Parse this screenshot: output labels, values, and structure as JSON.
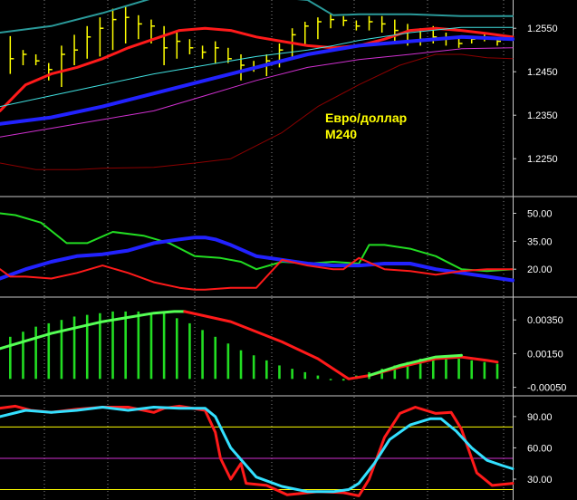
{
  "chart_data": [
    {
      "type": "line",
      "panel": "price",
      "annotation": [
        "Евро/доллар",
        "M240"
      ],
      "y_ticks": [
        "1.2550",
        "1.2450",
        "1.2350",
        "1.2250"
      ],
      "y_tick_values": [
        1.255,
        1.245,
        1.235,
        1.225
      ],
      "ylim": [
        1.2165,
        1.2615
      ],
      "xlim": [
        0,
        100
      ],
      "grid": "vertical dotted",
      "ohlc": {
        "color": "#ffff00",
        "x": [
          2,
          4.5,
          7,
          9.5,
          12,
          14.5,
          17,
          19.5,
          22,
          24.5,
          27,
          29.5,
          32,
          34.5,
          37,
          39.5,
          42,
          44.5,
          47,
          49.5,
          52,
          54.5,
          57,
          59.5,
          62,
          64.5,
          67,
          69.5,
          72,
          74.5,
          77,
          79.5,
          82,
          84.5,
          87,
          89.5,
          92,
          94.5,
          97
        ],
        "high": [
          1.2532,
          1.25,
          1.249,
          1.247,
          1.251,
          1.2535,
          1.2555,
          1.2575,
          1.2595,
          1.26,
          1.258,
          1.257,
          1.2555,
          1.254,
          1.2525,
          1.251,
          1.252,
          1.2505,
          1.249,
          1.2475,
          1.249,
          1.2515,
          1.255,
          1.2565,
          1.2575,
          1.2585,
          1.2578,
          1.2568,
          1.2578,
          1.2578,
          1.257,
          1.256,
          1.255,
          1.2555,
          1.254,
          1.253,
          1.253,
          1.254,
          1.253
        ],
        "low": [
          1.2445,
          1.2465,
          1.2465,
          1.243,
          1.2415,
          1.2465,
          1.248,
          1.2485,
          1.25,
          1.2515,
          1.2525,
          1.2515,
          1.2465,
          1.248,
          1.249,
          1.248,
          1.247,
          1.247,
          1.243,
          1.245,
          1.244,
          1.246,
          1.248,
          1.251,
          1.2525,
          1.255,
          1.2555,
          1.2545,
          1.2545,
          1.254,
          1.252,
          1.251,
          1.251,
          1.2515,
          1.251,
          1.2505,
          1.2515,
          1.252,
          1.251
        ],
        "close": [
          1.248,
          1.249,
          1.2475,
          1.2455,
          1.249,
          1.25,
          1.253,
          1.255,
          1.257,
          1.2575,
          1.256,
          1.2555,
          1.2505,
          1.252,
          1.2505,
          1.2495,
          1.2505,
          1.248,
          1.2465,
          1.246,
          1.2475,
          1.25,
          1.2535,
          1.2555,
          1.2565,
          1.257,
          1.2568,
          1.2555,
          1.2565,
          1.256,
          1.2545,
          1.252,
          1.2525,
          1.253,
          1.2525,
          1.2515,
          1.2525,
          1.253,
          1.252
        ]
      },
      "series": [
        {
          "color": "#2a9a9a",
          "width": 2,
          "x": [
            0,
            10,
            20,
            30,
            40,
            50,
            60,
            65,
            70,
            80,
            90,
            100
          ],
          "y": [
            1.254,
            1.2555,
            1.2585,
            1.262,
            1.263,
            1.2625,
            1.2615,
            1.258,
            1.2582,
            1.2582,
            1.2578,
            1.2578
          ]
        },
        {
          "color": "#ff1a1a",
          "width": 3,
          "x": [
            0,
            5,
            10,
            15,
            20,
            25,
            30,
            35,
            40,
            45,
            50,
            55,
            60,
            65,
            70,
            75,
            80,
            85,
            90,
            95,
            100
          ],
          "y": [
            1.236,
            1.242,
            1.2445,
            1.246,
            1.248,
            1.2505,
            1.2525,
            1.2545,
            1.255,
            1.2545,
            1.253,
            1.252,
            1.251,
            1.2505,
            1.251,
            1.2525,
            1.2545,
            1.255,
            1.2545,
            1.2538,
            1.253
          ]
        },
        {
          "color": "#40e0e0",
          "width": 1,
          "x": [
            0,
            10,
            20,
            30,
            40,
            50,
            60,
            65,
            70,
            80,
            90,
            100
          ],
          "y": [
            1.237,
            1.2395,
            1.242,
            1.2445,
            1.2465,
            1.2485,
            1.25,
            1.251,
            1.2522,
            1.254,
            1.2552,
            1.2552
          ]
        },
        {
          "color": "#2222ff",
          "width": 4,
          "x": [
            0,
            10,
            20,
            30,
            40,
            50,
            60,
            70,
            80,
            90,
            100
          ],
          "y": [
            1.233,
            1.2345,
            1.237,
            1.24,
            1.243,
            1.246,
            1.249,
            1.251,
            1.252,
            1.253,
            1.2525
          ]
        },
        {
          "color": "#d030d0",
          "width": 1,
          "x": [
            0,
            10,
            20,
            30,
            40,
            50,
            60,
            70,
            80,
            90,
            100
          ],
          "y": [
            1.23,
            1.232,
            1.234,
            1.236,
            1.2395,
            1.243,
            1.246,
            1.2478,
            1.249,
            1.2503,
            1.2505
          ]
        },
        {
          "color": "#8b0000",
          "width": 1,
          "x": [
            0,
            7,
            15,
            20,
            30,
            38,
            45,
            55,
            62,
            70,
            78,
            85,
            90,
            95,
            100
          ],
          "y": [
            1.224,
            1.2225,
            1.2225,
            1.2228,
            1.223,
            1.224,
            1.225,
            1.231,
            1.237,
            1.242,
            1.2465,
            1.249,
            1.249,
            1.2482,
            1.248
          ]
        }
      ]
    },
    {
      "type": "line",
      "panel": "dmi",
      "y_ticks": [
        "50.00",
        "35.00",
        "20.00"
      ],
      "y_tick_values": [
        50,
        35,
        20
      ],
      "ylim": [
        5.5,
        58.5
      ],
      "xlim": [
        0,
        100
      ],
      "grid": "vertical dotted",
      "series": [
        {
          "color": "#22dd22",
          "width": 2,
          "x": [
            0,
            3,
            8,
            13,
            17,
            22,
            28,
            33,
            38,
            43,
            47,
            50,
            55,
            60,
            65,
            70,
            72,
            75,
            80,
            85,
            90,
            95,
            100
          ],
          "y": [
            50,
            49,
            45,
            34,
            34,
            40,
            38,
            34,
            27,
            26,
            24,
            20,
            24,
            23,
            24,
            23,
            33,
            33,
            31,
            27,
            20,
            19,
            20
          ]
        },
        {
          "color": "#2222ff",
          "width": 4,
          "x": [
            0,
            5,
            10,
            15,
            20,
            25,
            30,
            35,
            38,
            40,
            42,
            45,
            50,
            55,
            60,
            65,
            70,
            75,
            80,
            85,
            90,
            95,
            100
          ],
          "y": [
            15,
            20,
            24,
            27,
            28,
            30,
            34,
            36,
            37,
            37,
            36,
            33,
            27,
            25,
            23,
            22,
            22,
            23,
            23,
            20,
            18,
            16,
            14
          ]
        },
        {
          "color": "#ff1a1a",
          "width": 2,
          "x": [
            0,
            2,
            5,
            10,
            15,
            20,
            25,
            30,
            35,
            38,
            40,
            45,
            50,
            55,
            60,
            65,
            67,
            70,
            75,
            80,
            85,
            90,
            95,
            100
          ],
          "y": [
            20,
            16,
            16,
            15,
            18,
            22,
            18,
            13,
            10,
            9,
            9,
            10,
            10,
            25,
            22,
            20,
            20,
            26,
            20,
            19,
            17,
            19,
            20,
            20
          ]
        }
      ]
    },
    {
      "type": "bar",
      "panel": "macd",
      "y_ticks": [
        "0.00350",
        "0.00150",
        "-0.00050"
      ],
      "y_tick_values": [
        0.0035,
        0.0015,
        -0.0005
      ],
      "ylim": [
        -0.00095,
        0.0048
      ],
      "xlim": [
        0,
        100
      ],
      "grid": "vertical dotted",
      "histogram": {
        "color": "#22dd22",
        "x": [
          2,
          4.5,
          7,
          9.5,
          12,
          14.5,
          17,
          19.5,
          22,
          24.5,
          27,
          29.5,
          32,
          34.5,
          37,
          39.5,
          42,
          44.5,
          47,
          49.5,
          52,
          54.5,
          57,
          59.5,
          62,
          64.5,
          67,
          69.5,
          72,
          74.5,
          77,
          79.5,
          82,
          84.5,
          87,
          89.5,
          92,
          94.5,
          97
        ],
        "values": [
          0.0025,
          0.0028,
          0.0031,
          0.0033,
          0.0035,
          0.0037,
          0.0038,
          0.0039,
          0.004,
          0.004,
          0.004,
          0.0039,
          0.0039,
          0.0036,
          0.0033,
          0.0029,
          0.0025,
          0.0021,
          0.0017,
          0.0014,
          0.0011,
          0.0008,
          0.0006,
          0.0004,
          0.0002,
          0.0,
          -0.0001,
          0.0002,
          0.0004,
          0.0006,
          0.0008,
          0.001,
          0.0012,
          0.0013,
          0.0013,
          0.0012,
          0.0011,
          0.001,
          0.0009
        ]
      },
      "series": [
        {
          "color": "#55ff55",
          "width": 3,
          "x": [
            0,
            10,
            20,
            30,
            34,
            36
          ],
          "y": [
            0.0018,
            0.0027,
            0.0034,
            0.0039,
            0.004,
            0.004
          ]
        },
        {
          "color": "#ff1a1a",
          "width": 3,
          "x": [
            36,
            45,
            55,
            62,
            66,
            68,
            72,
            78,
            85,
            90,
            95,
            97
          ],
          "y": [
            0.004,
            0.0034,
            0.0022,
            0.0012,
            0.0004,
            0.0,
            0.0002,
            0.0007,
            0.0012,
            0.0013,
            0.0011,
            0.001
          ]
        },
        {
          "color": "#55ff55",
          "width": 3,
          "x": [
            72,
            78,
            85,
            90
          ],
          "y": [
            0.0002,
            0.0008,
            0.0013,
            0.0014
          ]
        }
      ]
    },
    {
      "type": "line",
      "panel": "stochastic",
      "y_ticks": [
        "90.00",
        "60.00",
        "30.00"
      ],
      "y_tick_values": [
        90,
        60,
        30
      ],
      "ylim": [
        10,
        109
      ],
      "xlim": [
        0,
        100
      ],
      "grid": "vertical dotted",
      "hlines": [
        {
          "value": 80,
          "color": "#ffff00"
        },
        {
          "value": 50,
          "color": "#d030d0"
        },
        {
          "value": 20,
          "color": "#ffff00"
        }
      ],
      "series": [
        {
          "color": "#ff1a1a",
          "width": 3,
          "x": [
            0,
            3,
            6,
            10,
            15,
            20,
            25,
            30,
            32,
            35,
            40,
            42,
            43,
            45,
            47,
            48,
            52,
            56,
            58,
            62,
            67,
            70,
            72,
            75,
            78,
            81,
            85,
            88,
            90,
            93,
            96,
            100
          ],
          "y": [
            98,
            100,
            96,
            94,
            97,
            99,
            99,
            94,
            98,
            100,
            96,
            75,
            50,
            30,
            45,
            26,
            24,
            15,
            16,
            18,
            17,
            14,
            30,
            70,
            93,
            99,
            93,
            94,
            78,
            36,
            24,
            26
          ]
        },
        {
          "color": "#33e0ff",
          "width": 3,
          "x": [
            0,
            5,
            10,
            15,
            20,
            25,
            30,
            35,
            40,
            42,
            45,
            50,
            55,
            60,
            65,
            68,
            70,
            73,
            76,
            80,
            84,
            86,
            89,
            92,
            95,
            98,
            100
          ],
          "y": [
            90,
            96,
            94,
            96,
            99,
            96,
            99,
            98,
            98,
            90,
            60,
            32,
            23,
            18,
            18,
            20,
            26,
            45,
            68,
            82,
            88,
            88,
            76,
            60,
            48,
            43,
            40
          ]
        }
      ]
    }
  ]
}
